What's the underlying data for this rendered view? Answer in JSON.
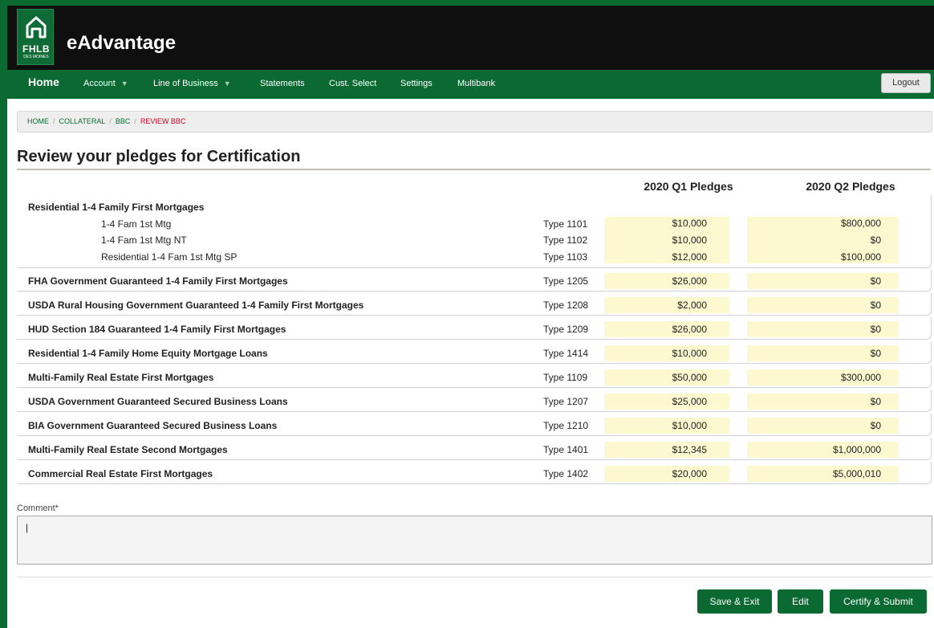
{
  "brand": {
    "logo_text": "FHLB",
    "logo_subtext": "DES MOINES",
    "app_title": "eAdvantage"
  },
  "nav": {
    "home": "Home",
    "account": "Account",
    "line_of_business": "Line of Business",
    "statements": "Statements",
    "cust_select": "Cust. Select",
    "settings": "Settings",
    "multibank": "Multibank",
    "logout": "Logout"
  },
  "breadcrumb": [
    "HOME",
    "COLLATERAL",
    "BBC",
    "REVIEW BBC"
  ],
  "page": {
    "title": "Review your pledges for Certification"
  },
  "columns": {
    "q1": "2020 Q1 Pledges",
    "q2": "2020 Q2 Pledges"
  },
  "residential_group": {
    "heading": "Residential 1-4 Family First Mortgages",
    "items": [
      {
        "label": "1-4 Fam 1st Mtg",
        "type": "Type 1101",
        "q1": "$10,000",
        "q2": "$800,000"
      },
      {
        "label": "1-4 Fam 1st Mtg NT",
        "type": "Type 1102",
        "q1": "$10,000",
        "q2": "$0"
      },
      {
        "label": "Residential 1-4 Fam 1st Mtg SP",
        "type": "Type 1103",
        "q1": "$12,000",
        "q2": "$100,000"
      }
    ]
  },
  "rows": [
    {
      "label": "FHA Government Guaranteed 1-4 Family First Mortgages",
      "type": "Type 1205",
      "q1": "$26,000",
      "q2": "$0"
    },
    {
      "label": "USDA Rural Housing Government Guaranteed 1-4 Family First Mortgages",
      "type": "Type 1208",
      "q1": "$2,000",
      "q2": "$0"
    },
    {
      "label": "HUD Section 184 Guaranteed 1-4 Family First Mortgages",
      "type": "Type 1209",
      "q1": "$26,000",
      "q2": "$0"
    },
    {
      "label": "Residential 1-4 Family Home Equity Mortgage Loans",
      "type": "Type 1414",
      "q1": "$10,000",
      "q2": "$0"
    },
    {
      "label": "Multi-Family Real Estate First Mortgages",
      "type": "Type 1109",
      "q1": "$50,000",
      "q2": "$300,000"
    },
    {
      "label": "USDA Government Guaranteed Secured Business Loans",
      "type": "Type 1207",
      "q1": "$25,000",
      "q2": "$0"
    },
    {
      "label": "BIA Government Guaranteed Secured Business Loans",
      "type": "Type 1210",
      "q1": "$10,000",
      "q2": "$0"
    },
    {
      "label": "Multi-Family Real Estate Second Mortgages",
      "type": "Type 1401",
      "q1": "$12,345",
      "q2": "$1,000,000"
    },
    {
      "label": "Commercial Real Estate First Mortgages",
      "type": "Type 1402",
      "q1": "$20,000",
      "q2": "$5,000,010"
    }
  ],
  "comment": {
    "label": "Comment*",
    "value": "|"
  },
  "buttons": {
    "save_exit": "Save & Exit",
    "edit": "Edit",
    "certify_submit": "Certify & Submit"
  },
  "colors": {
    "brand_green": "#0a6a32",
    "header_black": "#0f0f0f",
    "highlight_yellow": "#fcf8cf",
    "breadcrumb_current": "#d0021b"
  },
  "icons": {
    "logo": "house-icon",
    "dropdown": "caret-down-icon"
  }
}
